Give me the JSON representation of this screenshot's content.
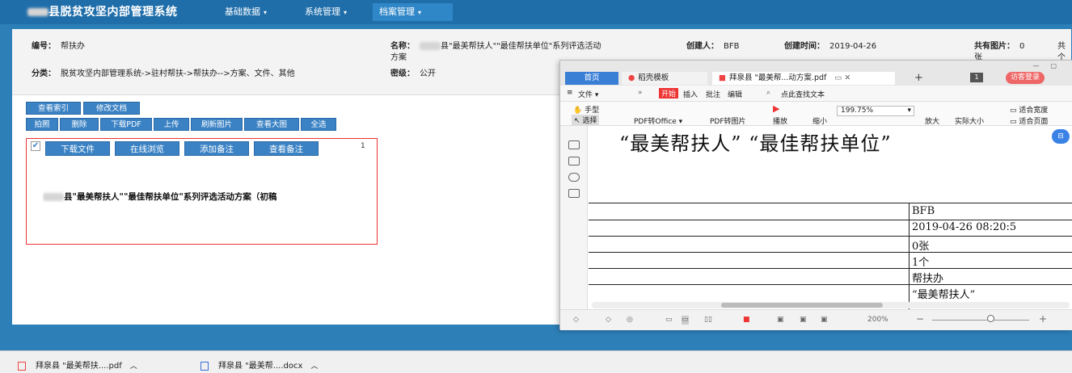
{
  "app": {
    "title": "县脱贫攻坚内部管理系统",
    "nav": [
      "基础数据",
      "系统管理",
      "档案管理"
    ]
  },
  "meta": {
    "code_label": "编号：",
    "code": "帮扶办",
    "name_label": "名称：",
    "name_line1": "县\"最美帮扶人\"\"最佳帮扶单位\"系列评选活动",
    "name_line2": "方案",
    "creator_label": "创建人：",
    "creator": "BFB",
    "created_label": "创建时间：",
    "created": "2019-04-26",
    "pics_label": "共有图片：",
    "pics": "0",
    "pics_unit": "张",
    "extra_label": "共",
    "extra_unit": "个",
    "category_label": "分类：",
    "category": "脱贫攻坚内部管理系统->驻村帮扶->帮扶办-->方案、文件、其他",
    "secret_label": "密级：",
    "secret": "公开"
  },
  "toolbar_row1": [
    "查看索引",
    "修改文档"
  ],
  "toolbar_row2": [
    "拍照",
    "删除",
    "下载PDF",
    "上传",
    "刷新图片",
    "查看大图",
    "全选"
  ],
  "card": {
    "buttons": [
      "下载文件",
      "在线浏览",
      "添加备注",
      "查看备注"
    ],
    "number": "1",
    "text": "县\"最美帮扶人\"\"最佳帮扶单位\"系列评选活动方案（初稿"
  },
  "downloads": [
    {
      "name": "拜泉县 \"最美帮扶....pdf"
    },
    {
      "name": "拜泉县 \"最美帮....docx"
    }
  ],
  "pdf": {
    "tabs": {
      "home": "首页",
      "template": "稻壳模板",
      "file": "拜泉县 \"最美帮...动方案.pdf"
    },
    "page_badge": "1",
    "login": "访客登录",
    "menu": {
      "file": "文件",
      "start": "开始",
      "insert": "插入",
      "comment": "批注",
      "edit": "编辑",
      "search": "点此查找文本"
    },
    "tools": {
      "hand": "手型",
      "select": "选择",
      "pdf_office": "PDF转Office",
      "pdf_image": "PDF转图片",
      "play": "播放",
      "zoom_out": "缩小",
      "zoom": "199.75%",
      "zoom_in": "放大",
      "actual": "实际大小",
      "fit_width": "适合宽度",
      "fit_page": "适合页面"
    },
    "doc_title": "“最美帮扶人” “最佳帮扶单位”",
    "cells": [
      "BFB",
      "2019-04-26 08:20:5",
      "0张",
      "1个",
      "帮扶办",
      "“最美帮扶人”"
    ],
    "status_zoom": "200%"
  }
}
